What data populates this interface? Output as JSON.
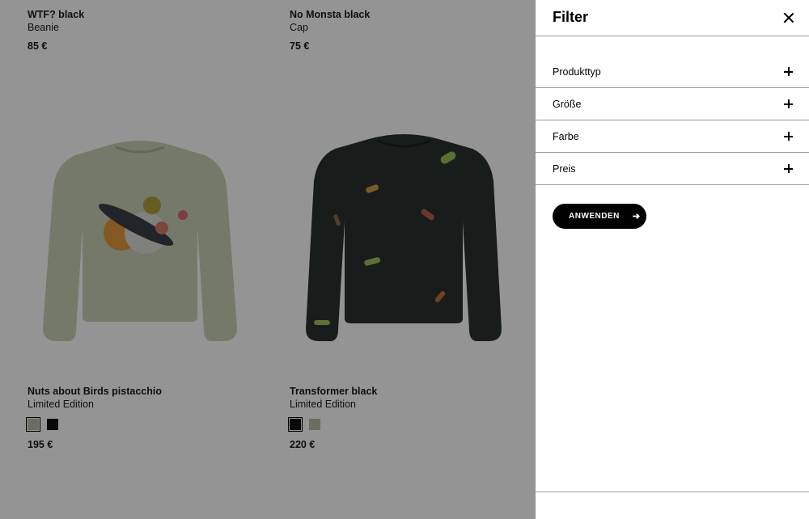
{
  "products": [
    {
      "name": "WTF? black",
      "subtitle": "Beanie",
      "price": "85 €"
    },
    {
      "name": "No Monsta black",
      "subtitle": "Cap",
      "price": "75 €"
    },
    {
      "name": "Nuts about Birds pistacchio",
      "subtitle": "Limited Edition",
      "price": "195 €",
      "swatches": [
        "#b7bca8",
        "#111111"
      ]
    },
    {
      "name": "Transformer black",
      "subtitle": "Limited Edition",
      "price": "220 €",
      "swatches": [
        "#111111",
        "#b7bca8"
      ]
    }
  ],
  "filter": {
    "title": "Filter",
    "items": [
      {
        "label": "Produkttyp"
      },
      {
        "label": "Größe"
      },
      {
        "label": "Farbe"
      },
      {
        "label": "Preis"
      }
    ],
    "apply_label": "ANWENDEN",
    "apply_arrow": "➔"
  },
  "colors": {
    "sweatshirt_pistacchio": "#c9d1b6",
    "sweatshirt_black": "#2a3330",
    "overlay": "rgba(0,0,0,0.42)"
  }
}
